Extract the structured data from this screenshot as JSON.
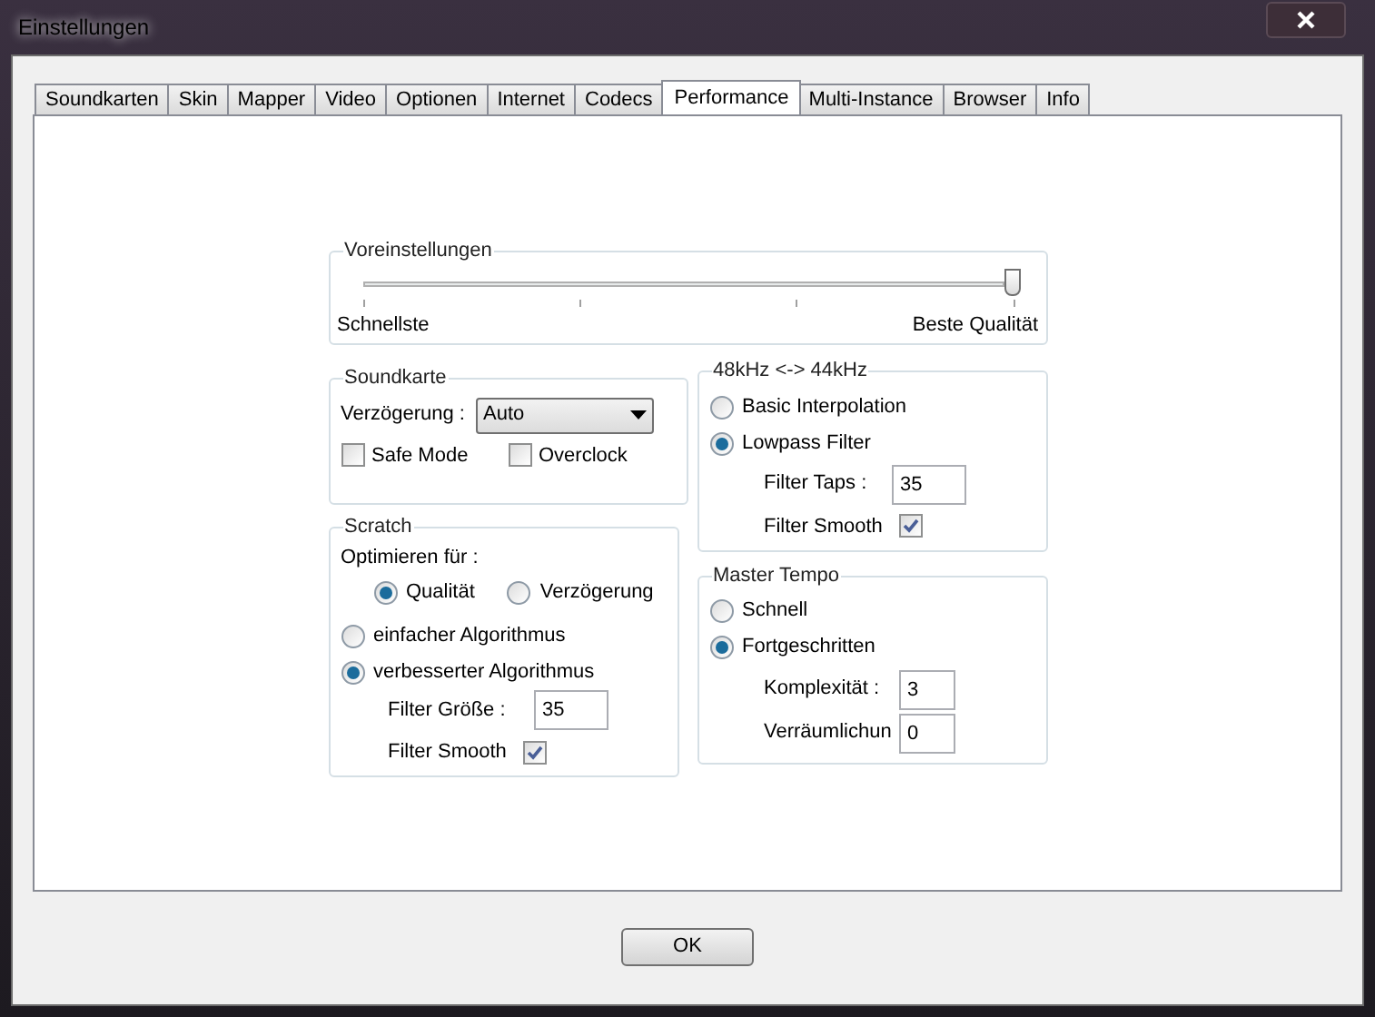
{
  "window": {
    "title": "Einstellungen"
  },
  "tabs": [
    {
      "label": "Soundkarten",
      "selected": false
    },
    {
      "label": "Skin",
      "selected": false
    },
    {
      "label": "Mapper",
      "selected": false
    },
    {
      "label": "Video",
      "selected": false
    },
    {
      "label": "Optionen",
      "selected": false
    },
    {
      "label": "Internet",
      "selected": false
    },
    {
      "label": "Codecs",
      "selected": false
    },
    {
      "label": "Performance",
      "selected": true
    },
    {
      "label": "Multi-Instance",
      "selected": false
    },
    {
      "label": "Browser",
      "selected": false
    },
    {
      "label": "Info",
      "selected": false
    }
  ],
  "presets": {
    "title": "Voreinstellungen",
    "level": 1,
    "min_label": "Schnellste",
    "max_label": "Beste Qualität"
  },
  "soundcard": {
    "title": "Soundkarte",
    "delay_label": "Verzögerung :",
    "delay_value": "Auto",
    "checkboxes": [
      {
        "label": "Safe Mode",
        "checked": false
      },
      {
        "label": "Overclock",
        "checked": false
      }
    ]
  },
  "scratch": {
    "title": "Scratch",
    "optimize_label": "Optimieren für :",
    "optimize_options": [
      {
        "label": "Qualität",
        "selected": true
      },
      {
        "label": "Verzögerung",
        "selected": false
      }
    ],
    "algorithms": [
      {
        "label": "einfacher Algorithmus",
        "selected": false
      },
      {
        "label": "verbesserter Algorithmus",
        "selected": true
      }
    ],
    "filter_size": {
      "label": "Filter Größe :",
      "value": "35"
    },
    "filter_smooth": {
      "label": "Filter Smooth",
      "checked": true
    }
  },
  "resample": {
    "title": "48kHz <-> 44kHz",
    "options": [
      {
        "label": "Basic Interpolation",
        "selected": false
      },
      {
        "label": "Lowpass Filter",
        "selected": true
      }
    ],
    "filter_taps": {
      "label": "Filter Taps :",
      "value": "35"
    },
    "filter_smooth": {
      "label": "Filter Smooth",
      "checked": true
    }
  },
  "master_tempo": {
    "title": "Master Tempo",
    "options": [
      {
        "label": "Schnell",
        "selected": false
      },
      {
        "label": "Fortgeschritten",
        "selected": true
      }
    ],
    "fields": [
      {
        "label": "Komplexität :",
        "value": "3"
      },
      {
        "label": "Verräumlichun",
        "value": "0"
      }
    ]
  },
  "ok_button": "OK"
}
